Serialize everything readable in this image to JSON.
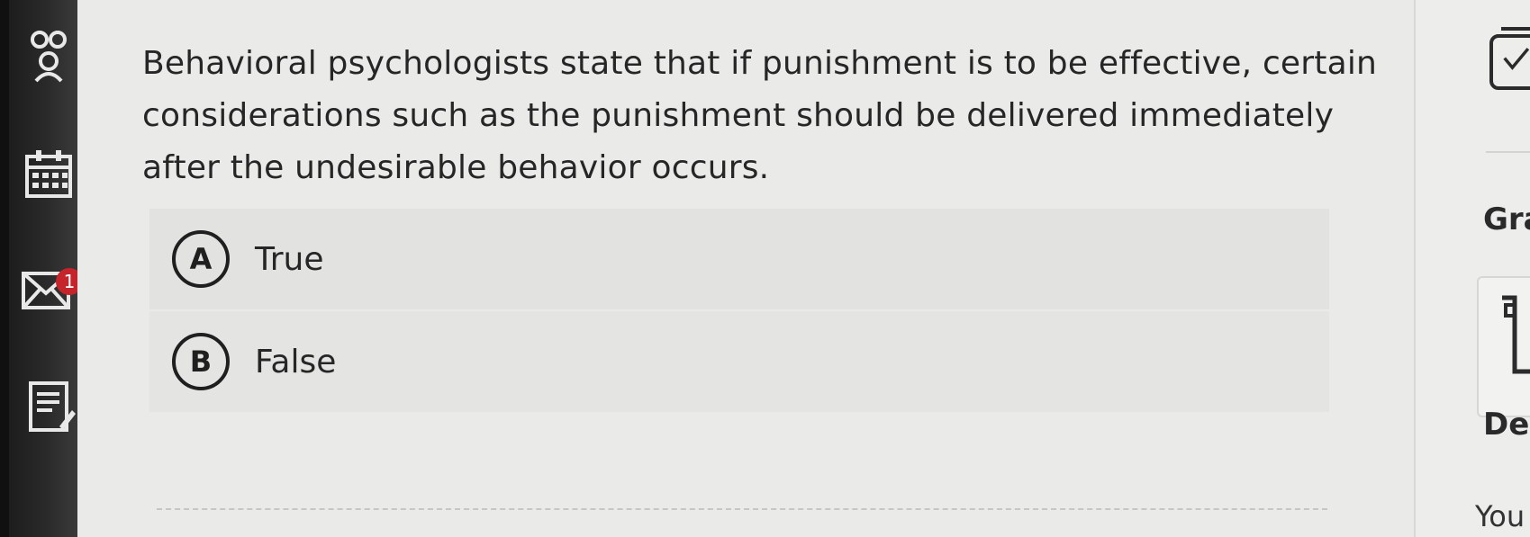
{
  "sidebar": {
    "icons": [
      "people-icon",
      "calendar-icon",
      "mail-icon",
      "assignment-icon"
    ],
    "mail_badge": "1"
  },
  "question": {
    "text": "Behavioral psychologists state that if punishment is to be effective, certain considerations such as the punishment should be delivered immediately after the undesirable behavior occurs."
  },
  "options": [
    {
      "letter": "A",
      "label": "True"
    },
    {
      "letter": "B",
      "label": "False"
    }
  ],
  "right_panel": {
    "grade_heading": "Gra",
    "desc_heading": "Des",
    "desc_text": "You"
  }
}
